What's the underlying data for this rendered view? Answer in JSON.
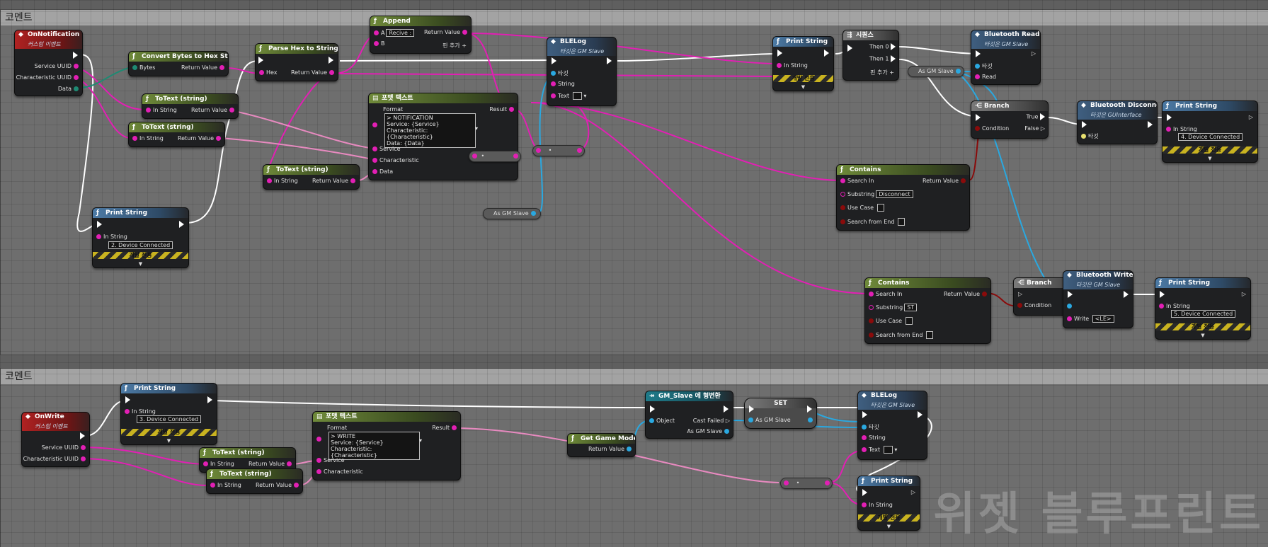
{
  "comments": [
    {
      "title": "코멘트"
    },
    {
      "title": "코멘트"
    }
  ],
  "common": {
    "dev_only": "개발 전용",
    "custom_event": "커스텀 이벤트",
    "target": "타깃",
    "add_pin": "핀 추가",
    "then0": "Then 0",
    "then1": "Then 1",
    "true": "True",
    "false": "False",
    "condition": "Condition",
    "return_value": "Return Value",
    "in_string": "In String",
    "search_in": "Search In",
    "substring": "Substring",
    "use_case": "Use Case",
    "search_from_end": "Search from End",
    "as_gm_slave": "As GM Slave",
    "result": "Result",
    "format": "Format",
    "target_gm_slave": "타깃은 GM Slave"
  },
  "nodes": {
    "on_notification": {
      "title": "OnNotification",
      "pins": [
        "Service UUID",
        "Characteristic UUID",
        "Data"
      ]
    },
    "convert_bytes": {
      "title": "Convert Bytes to Hex String",
      "in": "Bytes"
    },
    "parse_hex": {
      "title": "Parse Hex to String",
      "in": "Hex"
    },
    "append": {
      "title": "Append",
      "a": "A",
      "a_value": "Recive :",
      "b": "B"
    },
    "totext1": {
      "title": "ToText (string)"
    },
    "totext2": {
      "title": "ToText (string)"
    },
    "totext3": {
      "title": "ToText (string)"
    },
    "format_text1": {
      "title": "포맷 텍스트",
      "lines": [
        "> NOTIFICATION",
        "Service: {Service}",
        "Characteristic: {Characteristic}",
        "Data: {Data}"
      ],
      "pins": [
        "Service",
        "Characteristic",
        "Data"
      ]
    },
    "blelog1": {
      "title": "BLELog",
      "string": "String",
      "text": "Text"
    },
    "print1": {
      "title": "Print String",
      "value": "2. Device Connected"
    },
    "print2": {
      "title": "Print String"
    },
    "sequence": {
      "title": "시퀀스"
    },
    "bt_read": {
      "title": "Bluetooth Read",
      "read": "Read"
    },
    "branch1": {
      "title": "Branch"
    },
    "bt_disconnect": {
      "title": "Bluetooth Disconnect",
      "subtitle": "타깃은 GUInterface"
    },
    "print3": {
      "title": "Print String",
      "value": "4. Device Connected"
    },
    "contains1": {
      "title": "Contains",
      "substring": "Disconnect"
    },
    "contains2": {
      "title": "Contains",
      "substring": "ST"
    },
    "branch2": {
      "title": "Branch"
    },
    "bt_write": {
      "title": "Bluetooth Write",
      "write": "Write",
      "write_value": "<LE>"
    },
    "print4": {
      "title": "Print String",
      "value": "5. Device Connected"
    },
    "on_write": {
      "title": "OnWrite",
      "pins": [
        "Service UUID",
        "Characteristic UUID"
      ]
    },
    "print5": {
      "title": "Print String",
      "value": "3. Device Connected"
    },
    "totext4": {
      "title": "ToText (string)"
    },
    "totext5": {
      "title": "ToText (string)"
    },
    "format_text2": {
      "title": "포맷 텍스트",
      "lines": [
        "> WRITE",
        "Service: {Service}",
        "Characteristic: {Characteristic}"
      ],
      "pins": [
        "Service",
        "Characteristic"
      ]
    },
    "get_game_mode": {
      "title": "Get Game Mode"
    },
    "cast": {
      "title": "GM_Slave 에 형변환",
      "object": "Object",
      "cast_failed": "Cast Failed"
    },
    "set": {
      "title": "SET"
    },
    "blelog2": {
      "title": "BLELog",
      "string": "String",
      "text": "Text"
    },
    "print6": {
      "title": "Print String"
    }
  },
  "watermark": "위젯 블루프린트"
}
